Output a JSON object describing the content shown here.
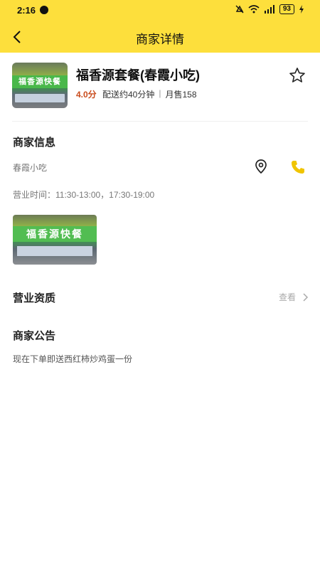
{
  "status_bar": {
    "time": "2:16",
    "battery": "93"
  },
  "header": {
    "title": "商家详情"
  },
  "shop": {
    "thumb_sign": "福香源快餐",
    "name": "福香源套餐(春霞小吃)",
    "rating": "4.0分",
    "delivery": "配送约40分钟",
    "separator": "|",
    "monthly_sales": "月售158"
  },
  "merchant_info": {
    "title": "商家信息",
    "category": "春霞小吃",
    "hours": "营业时间：11:30-13:00，17:30-19:00",
    "photo_sign": "福香源快餐"
  },
  "qualification": {
    "title": "营业资质",
    "view_label": "查看"
  },
  "announcement": {
    "title": "商家公告",
    "text": "现在下单即送西红柿炒鸡蛋一份"
  },
  "colors": {
    "header_bg": "#fddf3c",
    "rating": "#c94b1c",
    "phone_icon": "#f0c400"
  },
  "icons": [
    "back-arrow-icon",
    "star-icon",
    "location-pin-icon",
    "phone-icon",
    "chevron-right-icon"
  ]
}
